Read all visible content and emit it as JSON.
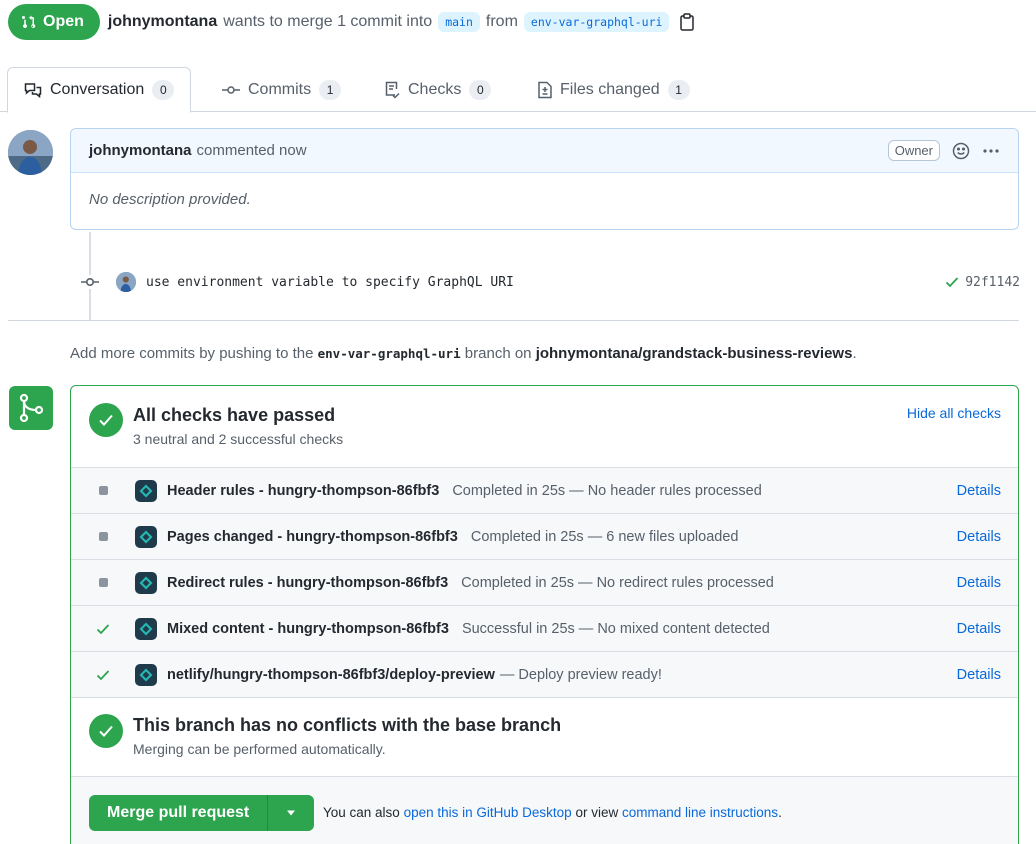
{
  "header": {
    "state_label": "Open",
    "author": "johnymontana",
    "text_pre": "wants to merge 1 commit into",
    "base_branch": "main",
    "text_from": "from",
    "head_branch": "env-var-graphql-uri"
  },
  "tabs": [
    {
      "label": "Conversation",
      "count": "0"
    },
    {
      "label": "Commits",
      "count": "1"
    },
    {
      "label": "Checks",
      "count": "0"
    },
    {
      "label": "Files changed",
      "count": "1"
    }
  ],
  "comment": {
    "author": "johnymontana",
    "action": "commented now",
    "badge": "Owner",
    "body": "No description provided."
  },
  "commit": {
    "message": "use environment variable to specify GraphQL URI",
    "sha": "92f1142"
  },
  "push_hint": {
    "pre": "Add more commits by pushing to the",
    "branch": "env-var-graphql-uri",
    "mid": "branch on",
    "repo": "johnymontana/grandstack-business-reviews",
    "post": "."
  },
  "checks_summary": {
    "title": "All checks have passed",
    "subtitle": "3 neutral and 2 successful checks",
    "hide_label": "Hide all checks"
  },
  "checks": [
    {
      "status": "neutral",
      "name": "Header rules - hungry-thompson-86fbf3",
      "desc": "Completed in 25s — No header rules processed",
      "details": "Details"
    },
    {
      "status": "neutral",
      "name": "Pages changed - hungry-thompson-86fbf3",
      "desc": "Completed in 25s — 6 new files uploaded",
      "details": "Details"
    },
    {
      "status": "neutral",
      "name": "Redirect rules - hungry-thompson-86fbf3",
      "desc": "Completed in 25s — No redirect rules processed",
      "details": "Details"
    },
    {
      "status": "success",
      "name": "Mixed content - hungry-thompson-86fbf3",
      "desc": "Successful in 25s — No mixed content detected",
      "details": "Details"
    },
    {
      "status": "success",
      "name": "netlify/hungry-thompson-86fbf3/deploy-preview",
      "desc": "— Deploy preview ready!",
      "details": "Details"
    }
  ],
  "conflicts": {
    "title": "This branch has no conflicts with the base branch",
    "subtitle": "Merging can be performed automatically."
  },
  "merge": {
    "button_label": "Merge pull request",
    "also_pre": "You can also",
    "desktop_link": "open this in GitHub Desktop",
    "also_mid": "or view",
    "cli_link": "command line instructions",
    "also_post": "."
  },
  "colors": {
    "success": "#2da44e",
    "link": "#0969da",
    "comment_header_bg": "#f1f8ff"
  },
  "icons": [
    "git-pull-request-icon",
    "copy-icon",
    "comment-discussion-icon",
    "git-commit-icon",
    "checklist-icon",
    "file-diff-icon",
    "smiley-icon",
    "kebab-horizontal-icon",
    "check-icon",
    "git-merge-icon",
    "netlify-icon",
    "triangle-down-icon"
  ]
}
